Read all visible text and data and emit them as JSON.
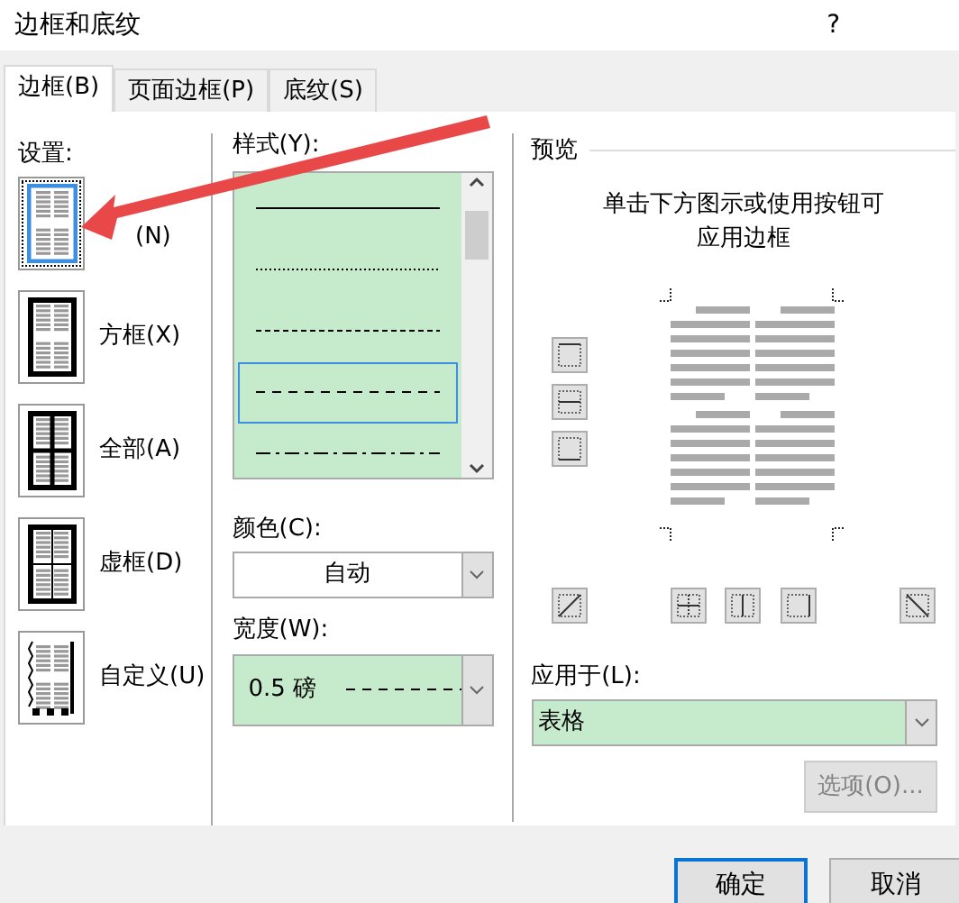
{
  "window": {
    "title": "边框和底纹",
    "help": "?"
  },
  "tabs": [
    {
      "label": "边框(B)",
      "selected": true
    },
    {
      "label": "页面边框(P)",
      "selected": false
    },
    {
      "label": "底纹(S)",
      "selected": false
    }
  ],
  "settings": {
    "label": "设置:",
    "items": [
      {
        "kind": "none",
        "label": "(N)",
        "selected": true
      },
      {
        "kind": "box",
        "label": "方框(X)",
        "selected": false
      },
      {
        "kind": "all",
        "label": "全部(A)",
        "selected": false
      },
      {
        "kind": "grid",
        "label": "虚框(D)",
        "selected": false
      },
      {
        "kind": "custom",
        "label": "自定义(U)",
        "selected": false
      }
    ]
  },
  "style": {
    "label": "样式(Y):",
    "items": [
      {
        "kind": "solid",
        "selected": false
      },
      {
        "kind": "dotted",
        "selected": false
      },
      {
        "kind": "fine-dash",
        "selected": false
      },
      {
        "kind": "dash",
        "selected": true
      },
      {
        "kind": "dash-dot",
        "selected": false
      }
    ]
  },
  "color": {
    "label": "颜色(C):",
    "value": "自动"
  },
  "width": {
    "label": "宽度(W):",
    "value": "0.5 磅"
  },
  "preview": {
    "title": "预览",
    "hint": "单击下方图示或使用按钮可应用边框"
  },
  "apply": {
    "label": "应用于(L):",
    "value": "表格"
  },
  "options_button": {
    "label": "选项(O)...",
    "disabled": true
  },
  "buttons": [
    {
      "label": "确定",
      "default": true
    },
    {
      "label": "取消",
      "default": false
    }
  ]
}
